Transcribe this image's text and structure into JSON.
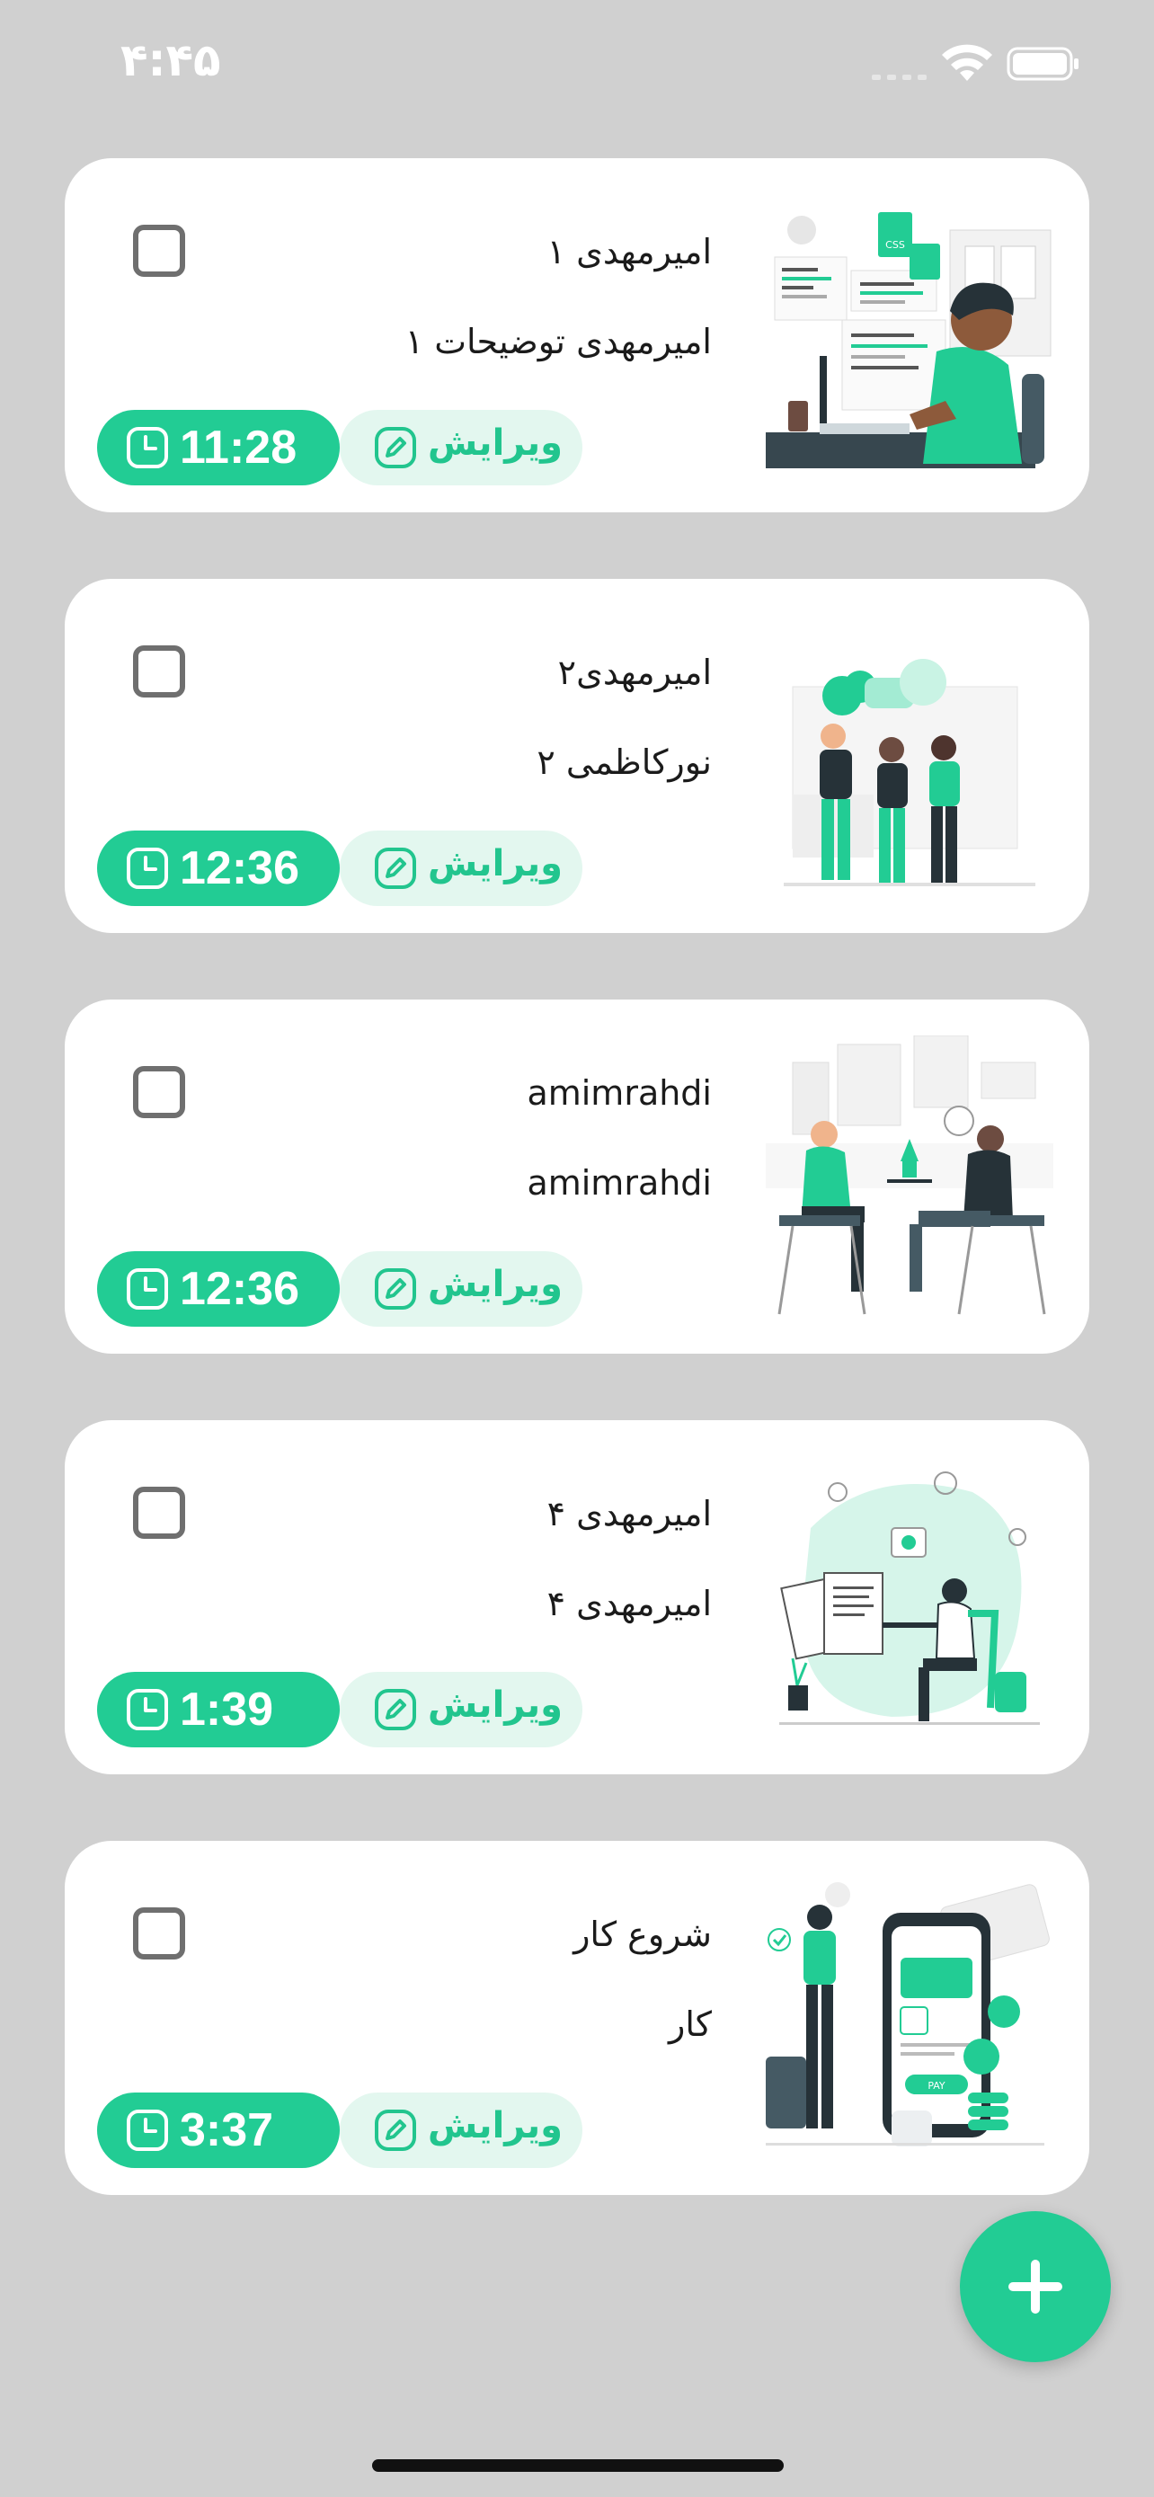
{
  "status_bar": {
    "time": "۴:۴۵"
  },
  "tasks": [
    {
      "title": "امیرمهدی ۱",
      "description": "امیرمهدی توضیحات ۱",
      "time": "11:28",
      "edit_label": "ویرایش",
      "checked": false,
      "illustration": "developer-at-computer-illustration"
    },
    {
      "title": "امیرمهدی۲",
      "description": "نورکاظمی ۲",
      "time": "12:36",
      "edit_label": "ویرایش",
      "checked": false,
      "illustration": "team-talking-illustration"
    },
    {
      "title": "amimrahdi",
      "description": "amimrahdi",
      "time": "12:36",
      "edit_label": "ویرایش",
      "checked": false,
      "illustration": "cafe-meeting-illustration"
    },
    {
      "title": "امیرمهدی ۴",
      "description": "امیرمهدی ۴",
      "time": "1:39",
      "edit_label": "ویرایش",
      "checked": false,
      "illustration": "studying-student-illustration"
    },
    {
      "title": "شروع کار",
      "description": "کار",
      "time": "3:37",
      "edit_label": "ویرایش",
      "checked": false,
      "illustration": "mobile-payment-illustration"
    }
  ],
  "fab": {
    "icon": "plus-icon"
  },
  "colors": {
    "accent": "#22cc94",
    "accent_light": "#e3f7ef",
    "background": "#d0d0d0",
    "card": "#ffffff"
  }
}
